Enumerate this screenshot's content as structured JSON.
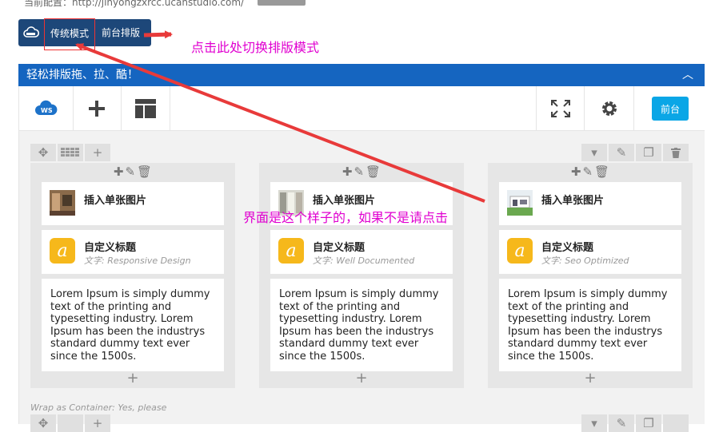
{
  "top": {
    "url_text": "当前配置：http://jinyongzxrcc.ucanstudio.com/",
    "grey_button": ""
  },
  "mode_bar": {
    "traditional_label": "传统模式",
    "front_layout_label": "前台排版"
  },
  "annotations": {
    "switch_hint": "点击此处切换排版模式",
    "interface_hint": "界面是这个样子的，如果不是请点击"
  },
  "editor": {
    "header_title": "轻松排版拖、拉、酷！",
    "collapse_glyph": "︿",
    "front_button": "前台"
  },
  "columns": [
    {
      "image_widget": "插入单张图片",
      "title_widget": "自定义标题",
      "subtitle": "文字: Responsive Design",
      "body": "Lorem Ipsum is simply dummy text of the printing and typesetting industry. Lorem Ipsum has been the industrys standard dummy text ever since the 1500s."
    },
    {
      "image_widget": "插入单张图片",
      "title_widget": "自定义标题",
      "subtitle": "文字: Well Documented",
      "body": "Lorem Ipsum is simply dummy text of the printing and typesetting industry. Lorem Ipsum has been the industrys standard dummy text ever since the 1500s."
    },
    {
      "image_widget": "插入单张图片",
      "title_widget": "自定义标题",
      "subtitle": "文字: Seo Optimized",
      "body": "Lorem Ipsum is simply dummy text of the printing and typesetting industry. Lorem Ipsum has been the industrys standard dummy text ever since the 1500s."
    }
  ],
  "wrap_label": "Wrap as Container: Yes, please",
  "colors": {
    "header_blue": "#1565c0",
    "mode_bar": "#1d4779",
    "annotation": "#e000d0",
    "arrow": "#e83a3a",
    "front_button": "#0aa6e6",
    "title_icon": "#f6b81b"
  },
  "icons": [
    "cloud-ws-icon",
    "plus-icon",
    "layout-icon",
    "fullscreen-icon",
    "gear-icon",
    "move-icon",
    "grid-icon",
    "pencil-icon",
    "trash-icon",
    "copy-icon",
    "chevron-down-icon"
  ]
}
